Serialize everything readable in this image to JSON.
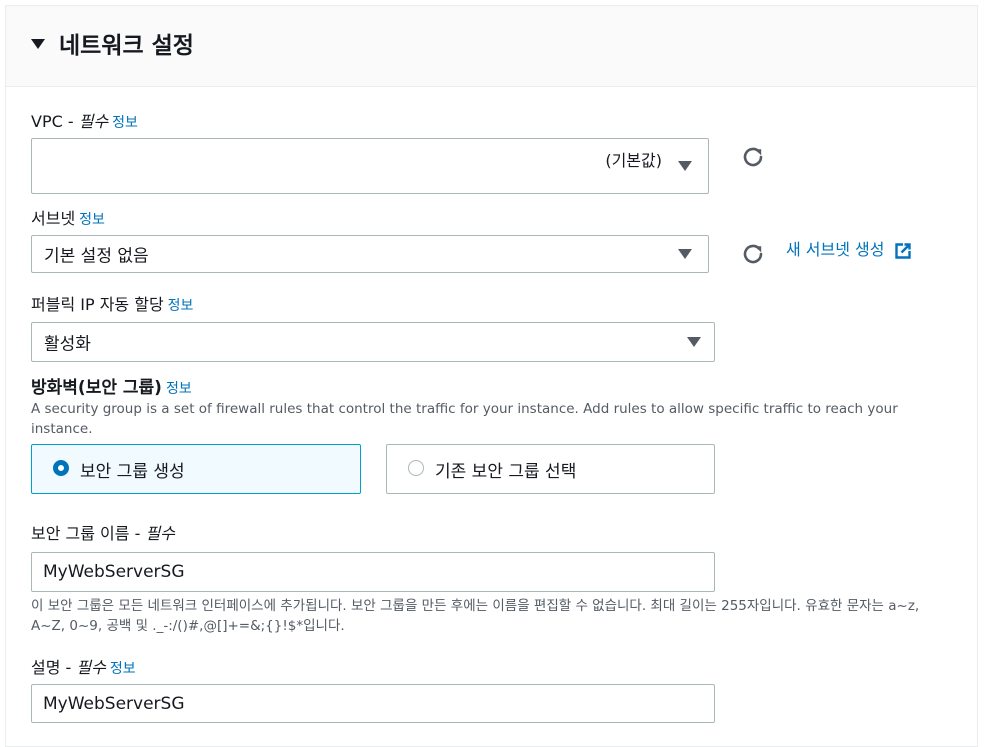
{
  "section": {
    "title": "네트워크 설정"
  },
  "vpc": {
    "label": "VPC - ",
    "required": "필수",
    "info": "정보",
    "value": "(기본값)"
  },
  "subnet": {
    "label": "서브넷",
    "info": "정보",
    "value": "기본 설정 없음",
    "new_link": "새 서브넷 생성"
  },
  "public_ip": {
    "label": "퍼블릭 IP 자동 할당",
    "info": "정보",
    "value": "활성화"
  },
  "firewall": {
    "label": "방화벽(보안 그룹)",
    "info": "정보",
    "description": "A security group is a set of firewall rules that control the traffic for your instance. Add rules to allow specific traffic to reach your instance.",
    "options": [
      {
        "label": "보안 그룹 생성",
        "selected": true
      },
      {
        "label": "기존 보안 그룹 선택",
        "selected": false
      }
    ]
  },
  "sg_name": {
    "label": "보안 그룹 이름 - ",
    "required": "필수",
    "value": "MyWebServerSG",
    "help": "이 보안 그룹은 모든 네트워크 인터페이스에 추가됩니다. 보안 그룹을 만든 후에는 이름을 편집할 수 없습니다. 최대 길이는 255자입니다. 유효한 문자는 a~z, A~Z, 0~9, 공백 및 ._-:/()#,@[]+=&;{}!$*입니다."
  },
  "description_field": {
    "label": "설명 - ",
    "required": "필수",
    "info": "정보",
    "value": "MyWebServerSG"
  },
  "colors": {
    "link": "#0073bb",
    "selected_bg": "#f1faff",
    "selected_border": "#00a1c9"
  },
  "icons": {
    "caret": "caret-down-icon",
    "refresh": "refresh-icon",
    "external": "external-link-icon"
  }
}
